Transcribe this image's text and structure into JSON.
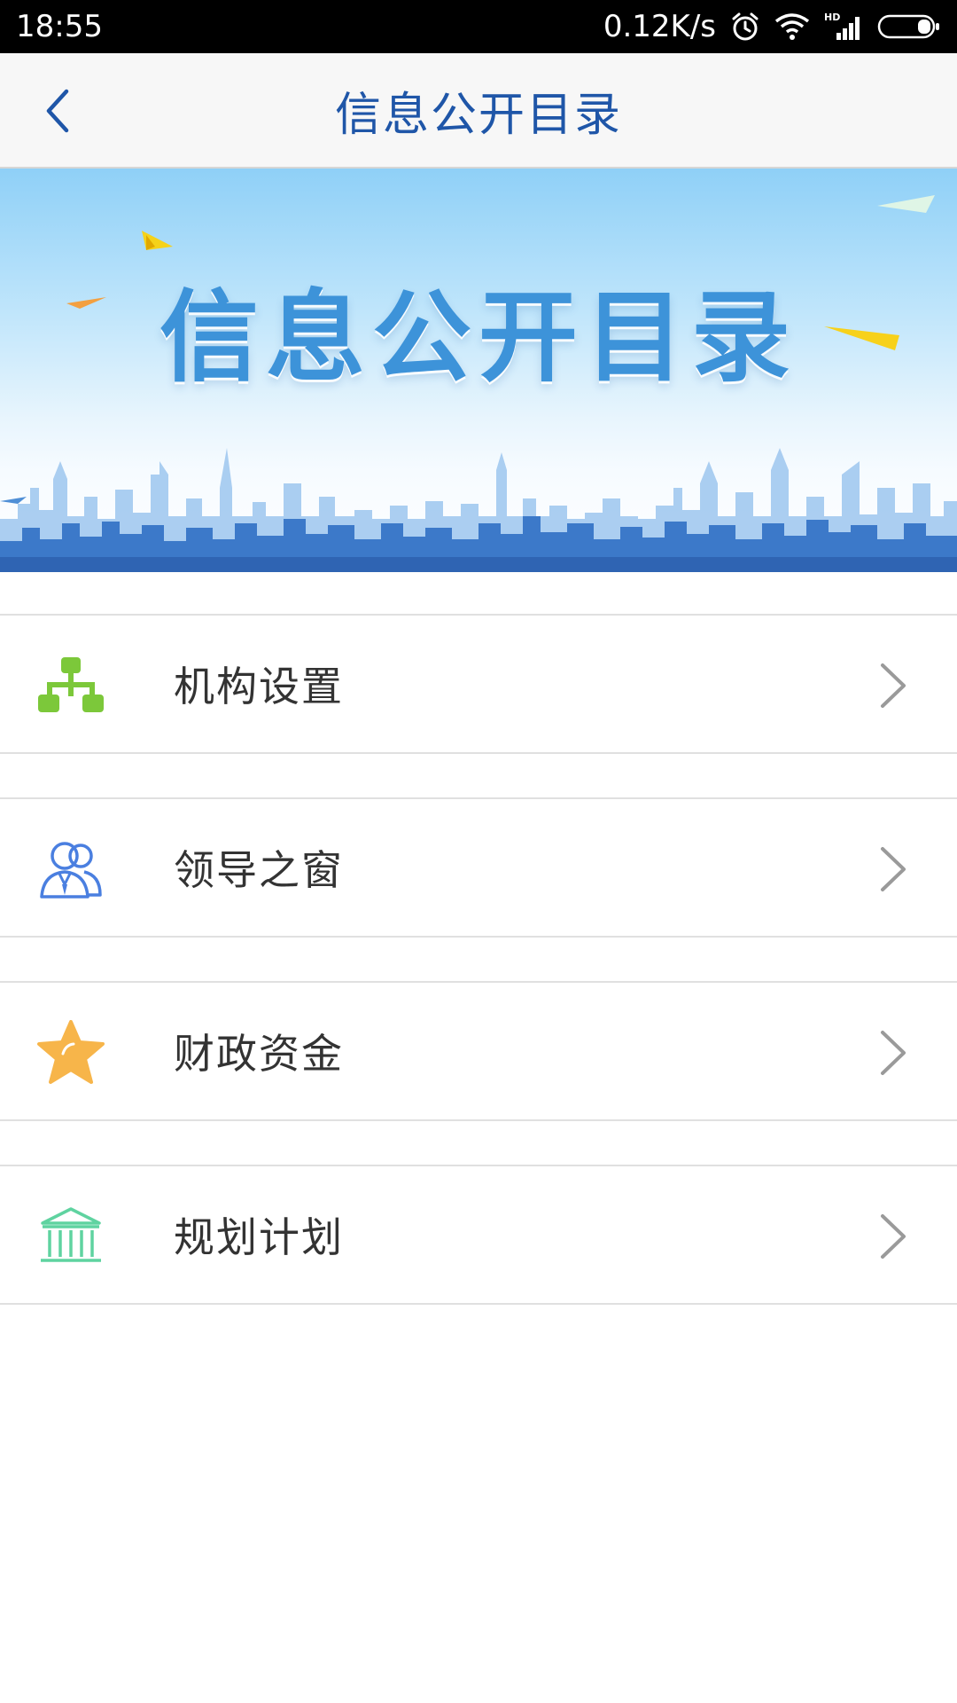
{
  "status_bar": {
    "time": "18:55",
    "network_speed": "0.12K/s",
    "icons": [
      "alarm-icon",
      "wifi-icon",
      "hd-signal-icon",
      "battery-icon"
    ]
  },
  "nav": {
    "back_icon": "chevron-left-icon",
    "title": "信息公开目录"
  },
  "banner": {
    "title": "信息公开目录"
  },
  "menu": {
    "items": [
      {
        "label": "机构设置",
        "icon": "org-chart-icon",
        "color": "#7cc83a"
      },
      {
        "label": "领导之窗",
        "icon": "users-icon",
        "color": "#4a7fe0"
      },
      {
        "label": "财政资金",
        "icon": "star-icon",
        "color": "#f7b54a"
      },
      {
        "label": "规划计划",
        "icon": "building-icon",
        "color": "#5fd3a0"
      }
    ]
  },
  "colors": {
    "accent": "#1f56a8",
    "banner_text": "#3d93d9",
    "chevron": "#9a9a9a"
  }
}
